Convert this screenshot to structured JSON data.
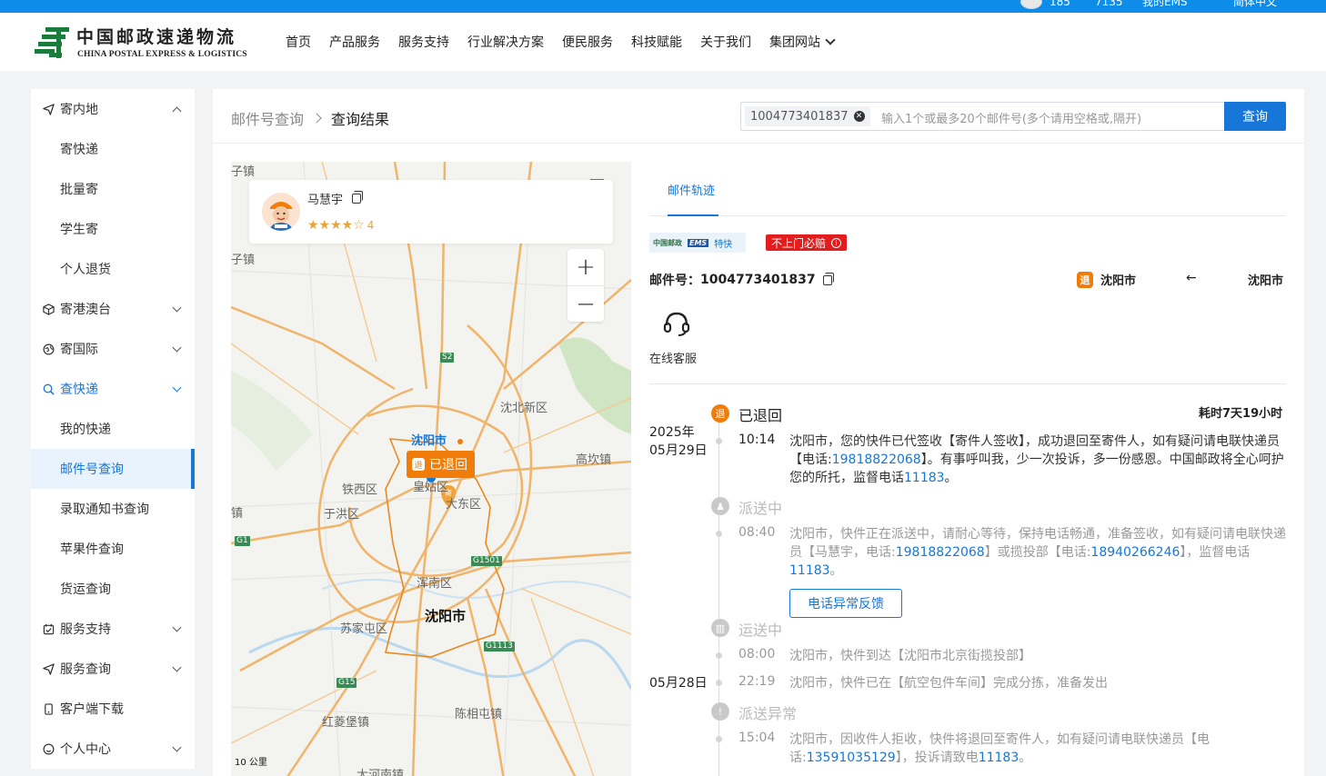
{
  "top_bar": {
    "items": [
      "185",
      "7135",
      "我的EMS",
      "简体中文"
    ]
  },
  "header": {
    "logo_cn": "中国邮政速递物流",
    "logo_en": "CHINA POSTAL EXPRESS & LOGISTICS",
    "nav": [
      "首页",
      "产品服务",
      "服务支持",
      "行业解决方案",
      "便民服务",
      "科技赋能",
      "关于我们",
      "集团网站"
    ]
  },
  "sidebar": {
    "items": [
      {
        "label": "寄内地",
        "type": "parent",
        "icon": "send-icon",
        "expanded": true
      },
      {
        "label": "寄快递",
        "type": "child"
      },
      {
        "label": "批量寄",
        "type": "child"
      },
      {
        "label": "学生寄",
        "type": "child"
      },
      {
        "label": "个人退货",
        "type": "child"
      },
      {
        "label": "寄港澳台",
        "type": "parent",
        "icon": "box-icon"
      },
      {
        "label": "寄国际",
        "type": "parent",
        "icon": "globe-icon"
      },
      {
        "label": "查快递",
        "type": "parent",
        "icon": "search-icon",
        "expanded": true,
        "active": true
      },
      {
        "label": "我的快递",
        "type": "child"
      },
      {
        "label": "邮件号查询",
        "type": "child",
        "active": true
      },
      {
        "label": "录取通知书查询",
        "type": "child"
      },
      {
        "label": "苹果件查询",
        "type": "child"
      },
      {
        "label": "货运查询",
        "type": "child"
      },
      {
        "label": "服务支持",
        "type": "parent",
        "icon": "calendar-icon"
      },
      {
        "label": "服务查询",
        "type": "parent",
        "icon": "send-icon"
      },
      {
        "label": "客户端下载",
        "type": "parent",
        "icon": "phone-icon"
      },
      {
        "label": "个人中心",
        "type": "parent",
        "icon": "user-icon"
      }
    ]
  },
  "breadcrumb": {
    "parent": "邮件号查询",
    "current": "查询结果"
  },
  "search": {
    "tag": "1004773401837",
    "placeholder": "输入1个或最多20个邮件号(多个请用空格或,隔开)",
    "button": "查询"
  },
  "map": {
    "courier_name": "马慧宇",
    "stars": "★★★★☆",
    "rating": "4",
    "labels": [
      "子镇",
      "子镇",
      "沈北新区",
      "沈阳市",
      "高坎镇",
      "铁西区",
      "于洪区",
      "皇姑区",
      "大东区",
      "浑南区",
      "沈阳市",
      "苏家屯区",
      "陈相屯镇",
      "红菱堡镇",
      "大河南镇",
      "镇"
    ],
    "roads": [
      "S2",
      "G1",
      "G1501",
      "G1113",
      "G15"
    ],
    "returned_badge": "已退回",
    "returned_badge_icon": "退",
    "scale": "10 公里"
  },
  "detail": {
    "tab": "邮件轨迹",
    "brand": {
      "cn": "中国邮政",
      "ems": "EMS",
      "type": "特快"
    },
    "guarantee": "不上门必赔",
    "tracking_label": "邮件号：",
    "tracking_no": "1004773401837",
    "origin_icon": "退",
    "origin": "沈阳市",
    "route_arrow": "←",
    "destination": "沈阳市",
    "support_label": "在线客服",
    "duration": "耗时7天19小时"
  },
  "timeline": {
    "statuses": [
      {
        "label": "已退回",
        "icon": "退",
        "current": true
      },
      {
        "label": "派送中",
        "icon": "♟"
      },
      {
        "label": "运送中",
        "icon": "▥"
      },
      {
        "label": "派送异常",
        "icon": "!"
      }
    ],
    "dates": [
      "2025年",
      "05月29日",
      "05月28日"
    ],
    "events": [
      {
        "time": "10:14",
        "parts": [
          "沈阳市，您的快件已代签收【寄件人签收】，成功退回至寄件人，如有疑问请电联快递员【电话:",
          "19818822068",
          "】。有事呼叫我，少一次投诉，多一份感恩。中国邮政将全心呵护您的所托，监督电话",
          "11183",
          "。"
        ]
      },
      {
        "time": "08:40",
        "parts": [
          "沈阳市，快件正在派送中，请耐心等待，保持电话畅通，准备签收，如有疑问请电联快递员【马慧宇，电话:",
          "19818822068",
          "】或揽投部【电话:",
          "18940266246",
          "】，监督电话",
          "11183",
          "。"
        ]
      },
      {
        "time": "08:00",
        "text": "沈阳市，快件到达【沈阳市北京街揽投部】"
      },
      {
        "time": "22:19",
        "text": "沈阳市，快件已在【航空包件车间】完成分拣，准备发出"
      },
      {
        "time": "15:04",
        "parts": [
          "沈阳市，因收件人拒收，快件将退回至寄件人，如有疑问请电联快递员【电话:",
          "13591035129",
          "】，投诉请致电",
          "11183",
          "。"
        ]
      }
    ],
    "feedback_button": "电话异常反馈"
  }
}
